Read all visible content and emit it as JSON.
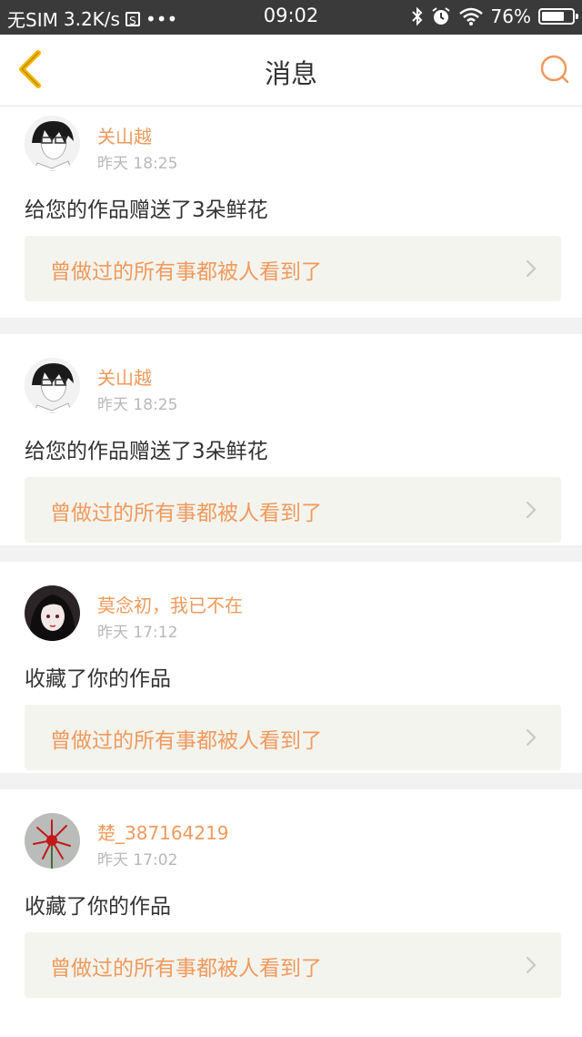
{
  "status_bar": {
    "carrier": "无SIM",
    "speed": "3.2K/s",
    "sim_icon_text": "S",
    "dots": "•••",
    "time": "09:02",
    "battery": "76%",
    "battery_level": 0.76,
    "icons": [
      "bluetooth-icon",
      "alarm-icon",
      "wifi-icon",
      "battery-icon"
    ]
  },
  "navbar": {
    "title": "消息",
    "back_icon": "chevron-left-icon",
    "search_icon": "search-icon",
    "accent": "#f5b400"
  },
  "colors": {
    "name": "#ef9a5d",
    "work_title": "#ef9a5d",
    "time": "#b8b8b8",
    "text": "#333333",
    "work_bg": "#f4f4ee",
    "separator": "#f2f2f2"
  },
  "notifications": [
    {
      "username": "关山越",
      "time": "昨天 18:25",
      "action": "给您的作品赠送了3朵鲜花",
      "work_title": "曾做过的所有事都被人看到了"
    },
    {
      "username": "关山越",
      "time": "昨天 18:25",
      "action": "给您的作品赠送了3朵鲜花",
      "work_title": "曾做过的所有事都被人看到了"
    },
    {
      "username": "莫念初，我已不在",
      "time": "昨天 17:12",
      "action": "收藏了你的作品",
      "work_title": "曾做过的所有事都被人看到了"
    },
    {
      "username": "楚_387164219",
      "time": "昨天 17:02",
      "action": "收藏了你的作品",
      "work_title": "曾做过的所有事都被人看到了"
    }
  ]
}
